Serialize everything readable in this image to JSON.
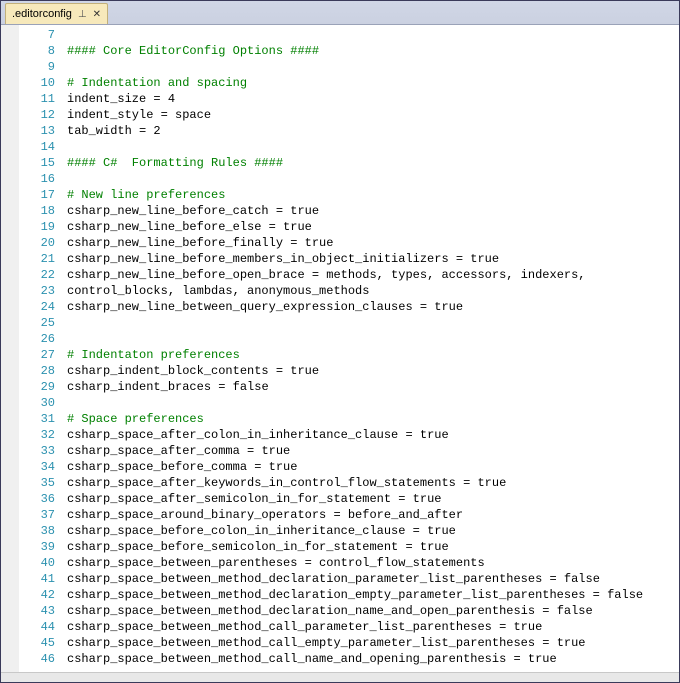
{
  "tab": {
    "filename": ".editorconfig"
  },
  "icons": {
    "pin": "⊥",
    "close": "✕"
  },
  "lines": [
    {
      "n": 7,
      "tokens": []
    },
    {
      "n": 8,
      "tokens": [
        {
          "cls": "tok-comment",
          "t": "#### Core EditorConfig Options ####"
        }
      ]
    },
    {
      "n": 9,
      "tokens": []
    },
    {
      "n": 10,
      "tokens": [
        {
          "cls": "tok-comment",
          "t": "# Indentation and spacing"
        }
      ]
    },
    {
      "n": 11,
      "tokens": [
        {
          "cls": "tok-key",
          "t": "indent_size"
        },
        {
          "cls": "tok-punct",
          "t": " = "
        },
        {
          "cls": "tok-value",
          "t": "4"
        }
      ]
    },
    {
      "n": 12,
      "tokens": [
        {
          "cls": "tok-key",
          "t": "indent_style"
        },
        {
          "cls": "tok-punct",
          "t": " = "
        },
        {
          "cls": "tok-value",
          "t": "space"
        }
      ]
    },
    {
      "n": 13,
      "tokens": [
        {
          "cls": "tok-key",
          "t": "tab_width"
        },
        {
          "cls": "tok-punct",
          "t": " = "
        },
        {
          "cls": "tok-value",
          "t": "2"
        }
      ]
    },
    {
      "n": 14,
      "tokens": []
    },
    {
      "n": 15,
      "tokens": [
        {
          "cls": "tok-comment",
          "t": "#### C#  Formatting Rules ####"
        }
      ]
    },
    {
      "n": 16,
      "tokens": []
    },
    {
      "n": 17,
      "tokens": [
        {
          "cls": "tok-comment",
          "t": "# New line preferences"
        }
      ]
    },
    {
      "n": 18,
      "tokens": [
        {
          "cls": "tok-key",
          "t": "csharp_new_line_before_catch"
        },
        {
          "cls": "tok-punct",
          "t": " = "
        },
        {
          "cls": "tok-value",
          "t": "true"
        }
      ]
    },
    {
      "n": 19,
      "tokens": [
        {
          "cls": "tok-key",
          "t": "csharp_new_line_before_else"
        },
        {
          "cls": "tok-punct",
          "t": " = "
        },
        {
          "cls": "tok-value",
          "t": "true"
        }
      ]
    },
    {
      "n": 20,
      "tokens": [
        {
          "cls": "tok-key",
          "t": "csharp_new_line_before_finally"
        },
        {
          "cls": "tok-punct",
          "t": " = "
        },
        {
          "cls": "tok-value",
          "t": "true"
        }
      ]
    },
    {
      "n": 21,
      "tokens": [
        {
          "cls": "tok-key",
          "t": "csharp_new_line_before_members_in_object_initializers"
        },
        {
          "cls": "tok-punct",
          "t": " = "
        },
        {
          "cls": "tok-value",
          "t": "true"
        }
      ]
    },
    {
      "n": 22,
      "tokens": [
        {
          "cls": "tok-key",
          "t": "csharp_new_line_before_open_brace"
        },
        {
          "cls": "tok-punct",
          "t": " = "
        },
        {
          "cls": "tok-value",
          "t": "methods, types, accessors, indexers,"
        }
      ]
    },
    {
      "n": 23,
      "tokens": [
        {
          "cls": "tok-value",
          "t": "control_blocks, lambdas, anonymous_methods"
        }
      ]
    },
    {
      "n": 24,
      "tokens": [
        {
          "cls": "tok-key",
          "t": "csharp_new_line_between_query_expression_clauses"
        },
        {
          "cls": "tok-punct",
          "t": " = "
        },
        {
          "cls": "tok-value",
          "t": "true"
        }
      ]
    },
    {
      "n": 25,
      "tokens": []
    },
    {
      "n": 26,
      "tokens": []
    },
    {
      "n": 27,
      "tokens": [
        {
          "cls": "tok-comment",
          "t": "# Indentaton preferences"
        }
      ]
    },
    {
      "n": 28,
      "tokens": [
        {
          "cls": "tok-key",
          "t": "csharp_indent_block_contents"
        },
        {
          "cls": "tok-punct",
          "t": " = "
        },
        {
          "cls": "tok-value",
          "t": "true"
        }
      ]
    },
    {
      "n": 29,
      "tokens": [
        {
          "cls": "tok-key",
          "t": "csharp_indent_braces"
        },
        {
          "cls": "tok-punct",
          "t": " = "
        },
        {
          "cls": "tok-value",
          "t": "false"
        }
      ]
    },
    {
      "n": 30,
      "tokens": []
    },
    {
      "n": 31,
      "tokens": [
        {
          "cls": "tok-comment",
          "t": "# Space preferences"
        }
      ]
    },
    {
      "n": 32,
      "tokens": [
        {
          "cls": "tok-key",
          "t": "csharp_space_after_colon_in_inheritance_clause"
        },
        {
          "cls": "tok-punct",
          "t": " = "
        },
        {
          "cls": "tok-value",
          "t": "true"
        }
      ]
    },
    {
      "n": 33,
      "tokens": [
        {
          "cls": "tok-key",
          "t": "csharp_space_after_comma"
        },
        {
          "cls": "tok-punct",
          "t": " = "
        },
        {
          "cls": "tok-value",
          "t": "true"
        }
      ]
    },
    {
      "n": 34,
      "tokens": [
        {
          "cls": "tok-key",
          "t": "csharp_space_before_comma"
        },
        {
          "cls": "tok-punct",
          "t": " = "
        },
        {
          "cls": "tok-value",
          "t": "true"
        }
      ]
    },
    {
      "n": 35,
      "tokens": [
        {
          "cls": "tok-key",
          "t": "csharp_space_after_keywords_in_control_flow_statements"
        },
        {
          "cls": "tok-punct",
          "t": " = "
        },
        {
          "cls": "tok-value",
          "t": "true"
        }
      ]
    },
    {
      "n": 36,
      "tokens": [
        {
          "cls": "tok-key",
          "t": "csharp_space_after_semicolon_in_for_statement"
        },
        {
          "cls": "tok-punct",
          "t": " = "
        },
        {
          "cls": "tok-value",
          "t": "true"
        }
      ]
    },
    {
      "n": 37,
      "tokens": [
        {
          "cls": "tok-key",
          "t": "csharp_space_around_binary_operators"
        },
        {
          "cls": "tok-punct",
          "t": " = "
        },
        {
          "cls": "tok-value",
          "t": "before_and_after"
        }
      ]
    },
    {
      "n": 38,
      "tokens": [
        {
          "cls": "tok-key",
          "t": "csharp_space_before_colon_in_inheritance_clause"
        },
        {
          "cls": "tok-punct",
          "t": " = "
        },
        {
          "cls": "tok-value",
          "t": "true"
        }
      ]
    },
    {
      "n": 39,
      "tokens": [
        {
          "cls": "tok-key",
          "t": "csharp_space_before_semicolon_in_for_statement"
        },
        {
          "cls": "tok-punct",
          "t": " = "
        },
        {
          "cls": "tok-value",
          "t": "true"
        }
      ]
    },
    {
      "n": 40,
      "tokens": [
        {
          "cls": "tok-key",
          "t": "csharp_space_between_parentheses"
        },
        {
          "cls": "tok-punct",
          "t": " = "
        },
        {
          "cls": "tok-value",
          "t": "control_flow_statements"
        }
      ]
    },
    {
      "n": 41,
      "tokens": [
        {
          "cls": "tok-key",
          "t": "csharp_space_between_method_declaration_parameter_list_parentheses"
        },
        {
          "cls": "tok-punct",
          "t": " = "
        },
        {
          "cls": "tok-value",
          "t": "false"
        }
      ]
    },
    {
      "n": 42,
      "tokens": [
        {
          "cls": "tok-key",
          "t": "csharp_space_between_method_declaration_empty_parameter_list_parentheses"
        },
        {
          "cls": "tok-punct",
          "t": " = "
        },
        {
          "cls": "tok-value",
          "t": "false"
        }
      ]
    },
    {
      "n": 43,
      "tokens": [
        {
          "cls": "tok-key",
          "t": "csharp_space_between_method_declaration_name_and_open_parenthesis"
        },
        {
          "cls": "tok-punct",
          "t": " = "
        },
        {
          "cls": "tok-value",
          "t": "false"
        }
      ]
    },
    {
      "n": 44,
      "tokens": [
        {
          "cls": "tok-key",
          "t": "csharp_space_between_method_call_parameter_list_parentheses"
        },
        {
          "cls": "tok-punct",
          "t": " = "
        },
        {
          "cls": "tok-value",
          "t": "true"
        }
      ]
    },
    {
      "n": 45,
      "tokens": [
        {
          "cls": "tok-key",
          "t": "csharp_space_between_method_call_empty_parameter_list_parentheses"
        },
        {
          "cls": "tok-punct",
          "t": " = "
        },
        {
          "cls": "tok-value",
          "t": "true"
        }
      ]
    },
    {
      "n": 46,
      "tokens": [
        {
          "cls": "tok-key",
          "t": "csharp_space_between_method_call_name_and_opening_parenthesis"
        },
        {
          "cls": "tok-punct",
          "t": " = "
        },
        {
          "cls": "tok-value",
          "t": "true"
        }
      ]
    }
  ]
}
